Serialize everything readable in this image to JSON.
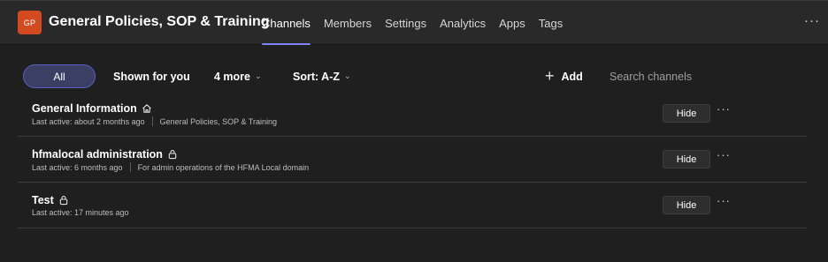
{
  "team": {
    "avatar_initials": "GP",
    "avatar_color": "#d34a20",
    "name": "General Policies, SOP & Training"
  },
  "tabs": [
    {
      "label": "Channels",
      "active": true
    },
    {
      "label": "Members"
    },
    {
      "label": "Settings"
    },
    {
      "label": "Analytics"
    },
    {
      "label": "Apps"
    },
    {
      "label": "Tags"
    }
  ],
  "header_more": "···",
  "filters": {
    "all": "All",
    "shown_for_you": "Shown for you",
    "more": "4 more",
    "sort": "Sort: A-Z",
    "chevron": "⌄"
  },
  "add": {
    "icon": "+",
    "label": "Add"
  },
  "search": {
    "placeholder": "Search channels"
  },
  "accent_color": "#7f85f5",
  "channels": [
    {
      "name": "General Information",
      "icon": "home-icon",
      "last_active": "Last active: about 2 months ago",
      "description": "General Policies, SOP & Training",
      "hide_label": "Hide",
      "more": "···"
    },
    {
      "name": "hfmalocal administration",
      "icon": "lock-icon",
      "last_active": "Last active: 6 months ago",
      "description": "For admin operations of the HFMA Local domain",
      "hide_label": "Hide",
      "more": "···"
    },
    {
      "name": "Test",
      "icon": "lock-icon",
      "last_active": "Last active: 17 minutes ago",
      "description": "",
      "hide_label": "Hide",
      "more": "···"
    }
  ]
}
